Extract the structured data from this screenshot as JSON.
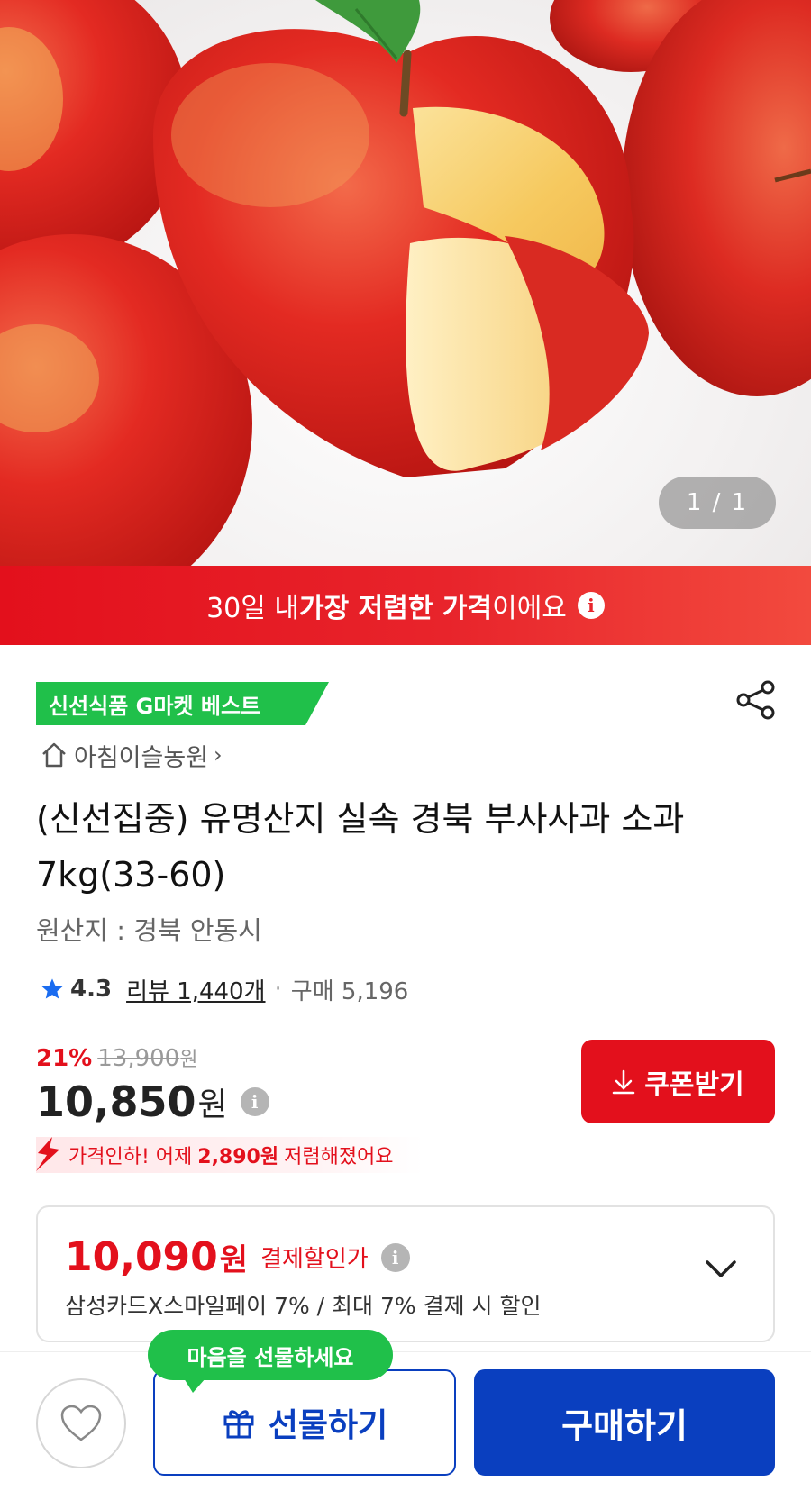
{
  "hero": {
    "pager_text": "1 / 1"
  },
  "banner": {
    "prefix": "30일 내 ",
    "highlight": "가장 저렴한 가격",
    "suffix": "이에요",
    "icon": "info-icon"
  },
  "badge": {
    "label": "신선식품 G마켓 베스트",
    "color": "#20c04a"
  },
  "seller": {
    "name": "아침이슬농원",
    "icon": "home-icon"
  },
  "product": {
    "title": "(신선집중) 유명산지 실속 경북 부사사과 소과 7kg(33-60)",
    "origin": "원산지 : 경북 안동시"
  },
  "rating": {
    "score": "4.3",
    "reviews": "리뷰 1,440개",
    "purchases": "구매 5,196"
  },
  "price": {
    "discount_pct": "21%",
    "original": "13,900",
    "original_unit": "원",
    "current": "10,850",
    "unit": "원"
  },
  "coupon": {
    "label": "쿠폰받기",
    "icon": "download-icon"
  },
  "price_drop": {
    "prefix": "가격인하! 어제",
    "amount": "2,890원",
    "suffix": "저렴해졌어요"
  },
  "payment_discount": {
    "price": "10,090",
    "unit": "원",
    "label": "결제할인가",
    "description": "삼성카드X스마일페이 7% / 최대 7% 결제 시 할인"
  },
  "bottom_bar": {
    "wish_icon": "heart-icon",
    "tooltip": "마음을 선물하세요",
    "gift_label": "선물하기",
    "gift_icon": "gift-icon",
    "buy_label": "구매하기"
  },
  "colors": {
    "accent_red": "#e3101c",
    "accent_blue": "#0a3fbf",
    "accent_green": "#20c04a"
  }
}
